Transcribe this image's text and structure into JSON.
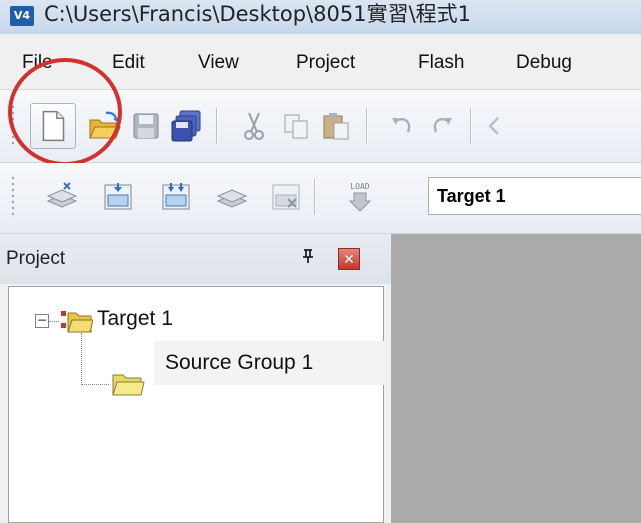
{
  "window": {
    "title": "C:\\Users\\Francis\\Desktop\\8051實習\\程式1",
    "app_icon_label": "V4"
  },
  "menu": [
    "File",
    "Edit",
    "View",
    "Project",
    "Flash",
    "Debug"
  ],
  "toolbar1": {
    "buttons": [
      "new-file-icon",
      "open-file-icon",
      "save-icon",
      "save-all-icon",
      "cut-icon",
      "copy-icon",
      "paste-icon",
      "undo-icon",
      "redo-icon"
    ]
  },
  "toolbar2": {
    "load_label": "LOAD",
    "target": "Target 1"
  },
  "project_panel": {
    "title": "Project",
    "pin_glyph": "ᵖ",
    "close_glyph": "✕",
    "tree": {
      "expander": "−",
      "root": "Target 1",
      "child": "Source Group 1"
    }
  },
  "colors": {
    "highlight": "#d2322d",
    "workspace": "#ababab",
    "folder": "#f2d35a"
  }
}
